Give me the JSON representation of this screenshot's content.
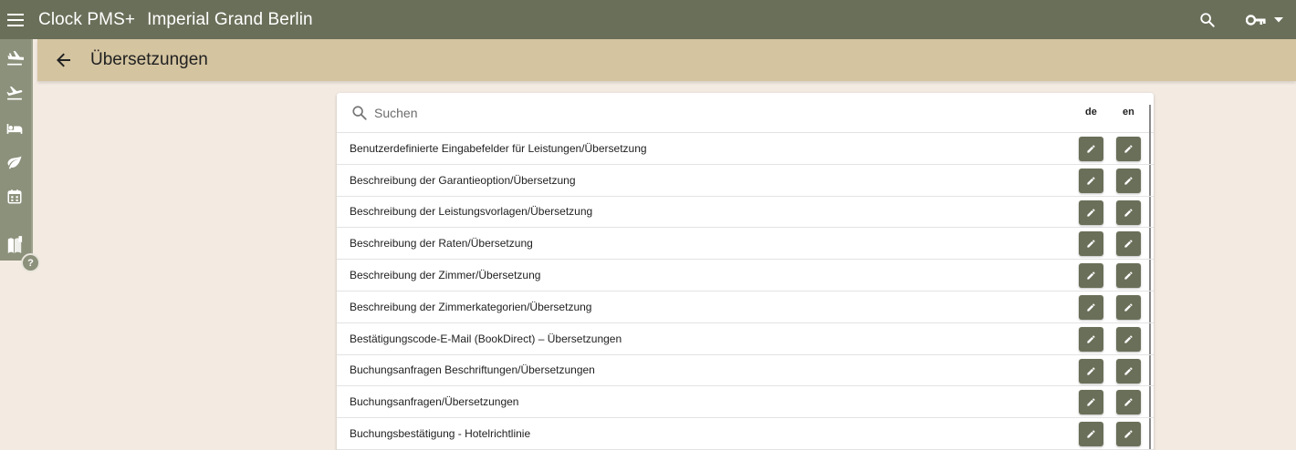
{
  "header": {
    "app_title": "Clock PMS+",
    "hotel_name": "Imperial Grand Berlin",
    "icons": [
      "menu-icon",
      "search-icon",
      "key-icon",
      "dropdown-arrow-icon"
    ]
  },
  "sidebar": {
    "items": [
      {
        "icon": "flight-land-icon"
      },
      {
        "icon": "flight-takeoff-icon"
      },
      {
        "icon": "bed-icon"
      },
      {
        "icon": "leaf-icon"
      },
      {
        "icon": "calendar-icon"
      },
      {
        "icon": "book-icon"
      }
    ],
    "help_label": "?"
  },
  "page": {
    "title": "Übersetzungen"
  },
  "search": {
    "placeholder": "Suchen"
  },
  "columns": {
    "de": "de",
    "en": "en"
  },
  "rows": [
    {
      "label": "Benutzerdefinierte Eingabefelder für Leistungen/Übersetzung"
    },
    {
      "label": "Beschreibung der Garantieoption/Übersetzung"
    },
    {
      "label": "Beschreibung der Leistungsvorlagen/Übersetzung"
    },
    {
      "label": "Beschreibung der Raten/Übersetzung"
    },
    {
      "label": "Beschreibung der Zimmer/Übersetzung"
    },
    {
      "label": "Beschreibung der Zimmerkategorien/Übersetzung"
    },
    {
      "label": "Bestätigungscode-E-Mail (BookDirect) – Übersetzungen"
    },
    {
      "label": "Buchungsanfragen Beschriftungen/Übersetzungen"
    },
    {
      "label": "Buchungsanfragen/Übersetzungen"
    },
    {
      "label": "Buchungsbestätigung - Hotelrichtlinie"
    }
  ],
  "colors": {
    "topbar": "#6a6f59",
    "subheader": "#d4c4a0",
    "background": "#f3ebe2",
    "button": "#6a6f59"
  }
}
